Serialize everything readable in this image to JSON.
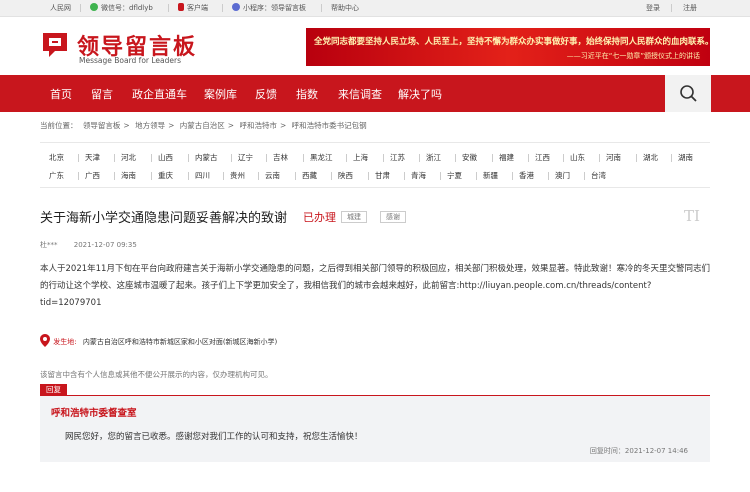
{
  "topbar": {
    "items": [
      "人民网",
      "微信号：dfldlyb",
      "客户端",
      "小程序：领导留言板",
      "帮助中心"
    ],
    "login": "登录",
    "register": "注册"
  },
  "logo": {
    "cn": "领导留言板",
    "en": "Message Board for Leaders"
  },
  "banner": {
    "line1": "全党同志都要坚持人民立场、人民至上，坚持不懈为群众办实事做好事，始终保持同人民群众的血肉联系。",
    "line2": "——习近平在“七一勋章”颁授仪式上的讲话"
  },
  "nav": [
    "首页",
    "留言",
    "政企直通车",
    "案例库",
    "反馈",
    "指数",
    "来信调查",
    "解决了吗"
  ],
  "breadcrumb": {
    "prefix": "当前位置：",
    "items": [
      "领导留言板",
      "地方领导",
      "内蒙古自治区",
      "呼和浩特市",
      "呼和浩特市委书记包钢"
    ]
  },
  "regions": {
    "row1": [
      "北京",
      "天津",
      "河北",
      "山西",
      "内蒙古",
      "辽宁",
      "吉林",
      "黑龙江",
      "上海",
      "江苏",
      "浙江",
      "安徽",
      "福建",
      "江西",
      "山东",
      "河南",
      "湖北",
      "湖南"
    ],
    "row2": [
      "广东",
      "广西",
      "海南",
      "重庆",
      "四川",
      "贵州",
      "云南",
      "西藏",
      "陕西",
      "甘肃",
      "青海",
      "宁夏",
      "新疆",
      "香港",
      "澳门",
      "台湾"
    ]
  },
  "post": {
    "title": "关于海新小学交通隐患问题妥善解决的致谢",
    "status": "已办理",
    "tags": [
      "城建",
      "感谢"
    ],
    "font_icon": "TI",
    "author": "杜***",
    "time": "2021-12-07 09:35",
    "content": "本人于2021年11月下旬在平台向政府建言关于海新小学交通隐患的问题，之后得到相关部门领导的积极回应，相关部门积极处理，效果显著。特此致谢！寒冷的冬天里交警同志们的行动让这个学校、这座城市温暖了起来。孩子们上下学更加安全了，我相信我们的城市会越来越好，此前留言:http://liuyan.people.com.cn/threads/content?tid=12079701",
    "location_label": "发生地:",
    "location": "内蒙古自治区呼和浩特市新城区家和小区对面(新城区海新小学)",
    "privacy_note": "该留言中含有个人信息或其他不便公开展示的内容，仅办理机构可见。"
  },
  "reply": {
    "tab": "回复",
    "org": "呼和浩特市委督查室",
    "body": "网民您好，您的留言已收悉。感谢您对我们工作的认可和支持，祝您生活愉快！",
    "time": "回复时间：2021-12-07 14:46"
  },
  "colors": {
    "brand": "#c8161d",
    "nav_bg": "#c8161d",
    "reply_bg": "#f2f3f5"
  },
  "icons": [
    "people-logo-icon",
    "wechat-icon",
    "phone-icon",
    "mini-program-icon",
    "search-icon",
    "location-pin-icon"
  ]
}
